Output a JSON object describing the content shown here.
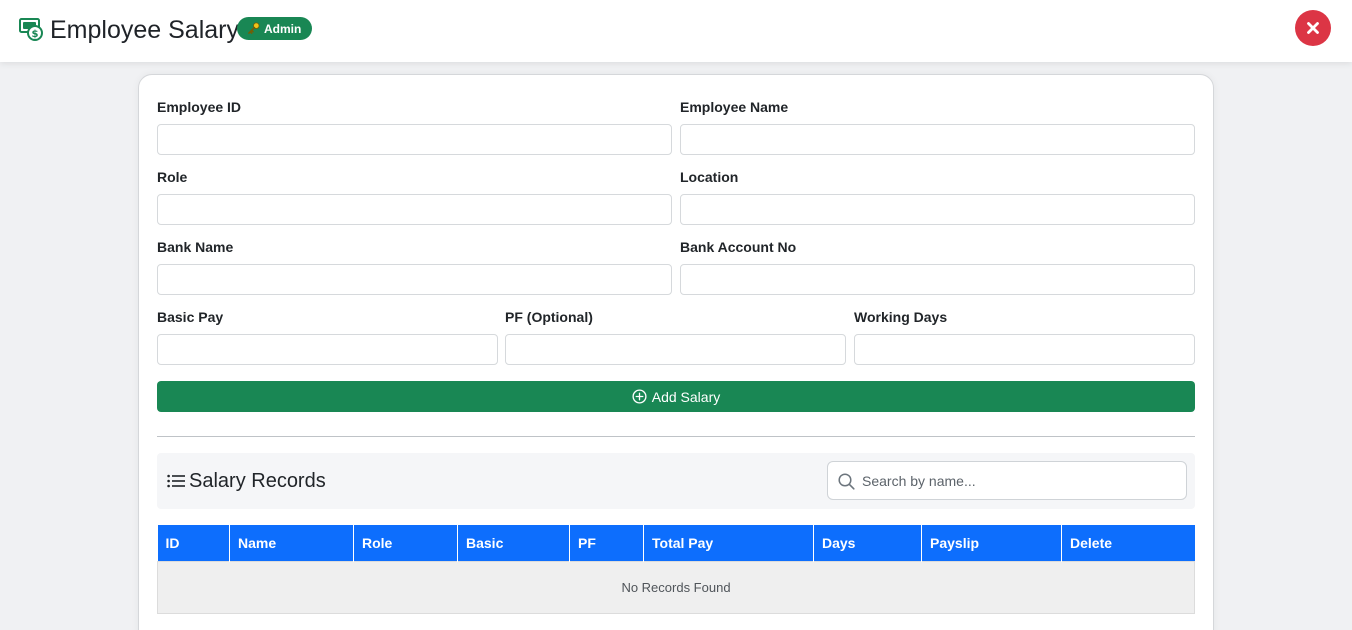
{
  "header": {
    "title": "Employee Salary",
    "badge": "Admin",
    "app_icon": "money-icon",
    "close_icon": "close-icon",
    "accent": "#198754",
    "danger": "#dc3545"
  },
  "form": {
    "employee_id": {
      "label": "Employee ID",
      "value": ""
    },
    "employee_name": {
      "label": "Employee Name",
      "value": ""
    },
    "role": {
      "label": "Role",
      "value": ""
    },
    "location": {
      "label": "Location",
      "value": ""
    },
    "bank_name": {
      "label": "Bank Name",
      "value": ""
    },
    "bank_account": {
      "label": "Bank Account No",
      "value": ""
    },
    "basic_pay": {
      "label": "Basic Pay",
      "value": ""
    },
    "pf": {
      "label": "PF (Optional)",
      "value": ""
    },
    "working_days": {
      "label": "Working Days",
      "value": ""
    },
    "submit_label": "Add Salary"
  },
  "records": {
    "title": "Salary Records",
    "search_placeholder": "Search by name...",
    "search_value": "",
    "columns": [
      "ID",
      "Name",
      "Role",
      "Basic",
      "PF",
      "Total Pay",
      "Days",
      "Payslip",
      "Delete"
    ],
    "rows": [],
    "empty_text": "No Records Found",
    "header_color": "#0d6efd"
  }
}
